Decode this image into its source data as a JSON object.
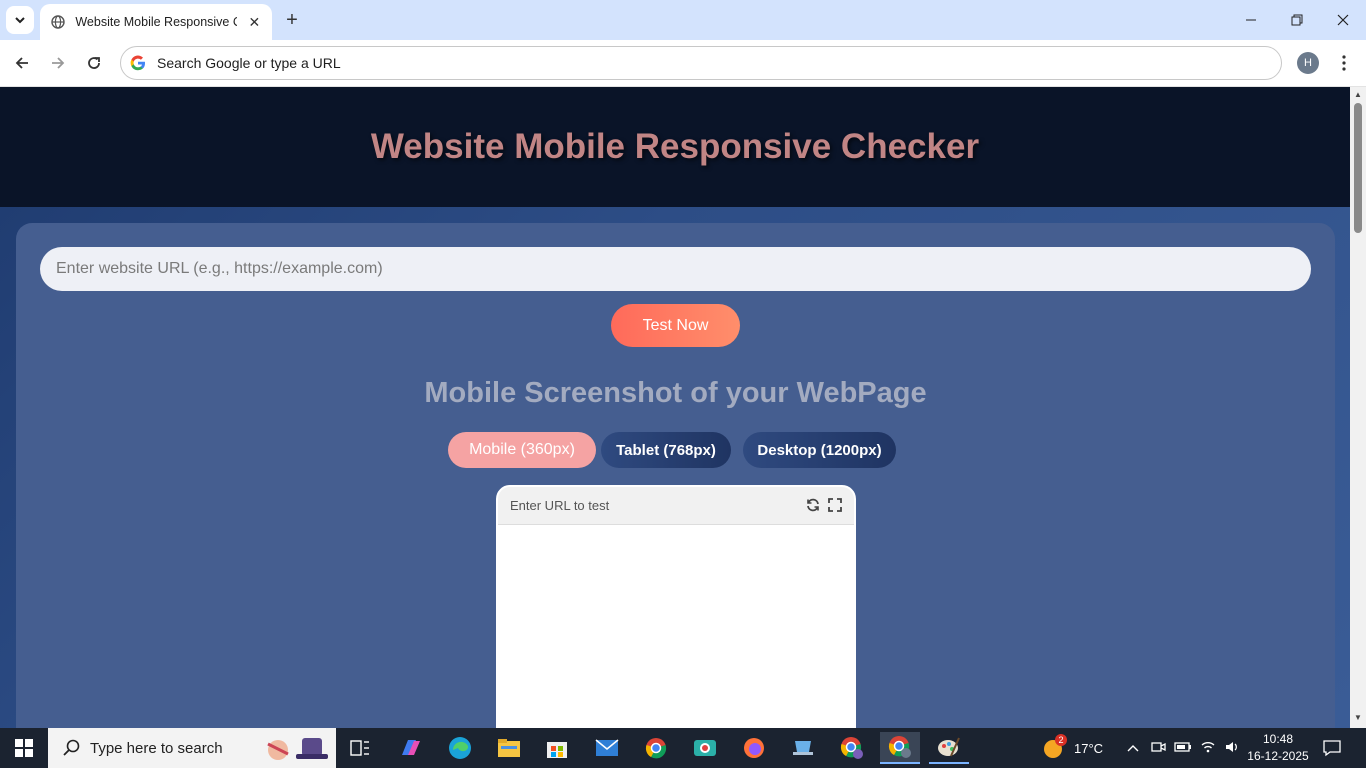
{
  "browser": {
    "tab_title": "Website Mobile Responsive Checker",
    "address_placeholder": "Search Google or type a URL",
    "profile_initial": "H"
  },
  "page": {
    "header_title": "Website Mobile Responsive Checker",
    "url_placeholder": "Enter website URL (e.g., https://example.com)",
    "test_button": "Test Now",
    "section_title": "Mobile Screenshot of your WebPage",
    "devices": [
      {
        "label": "Mobile (360px)",
        "active": true
      },
      {
        "label": "Tablet (768px)",
        "active": false
      },
      {
        "label": "Desktop (1200px)",
        "active": false
      }
    ],
    "preview_url_text": "Enter URL to test"
  },
  "taskbar": {
    "search_placeholder": "Type here to search",
    "weather": "17°C",
    "weather_badge": "2",
    "time": "10:48",
    "date": "16-12-2025"
  },
  "colors": {
    "header_bg": "#0a1428",
    "header_text": "#c18585",
    "card_bg": "#455e90",
    "accent_button": "#ff6a5a",
    "active_device": "#f5a3a3"
  }
}
